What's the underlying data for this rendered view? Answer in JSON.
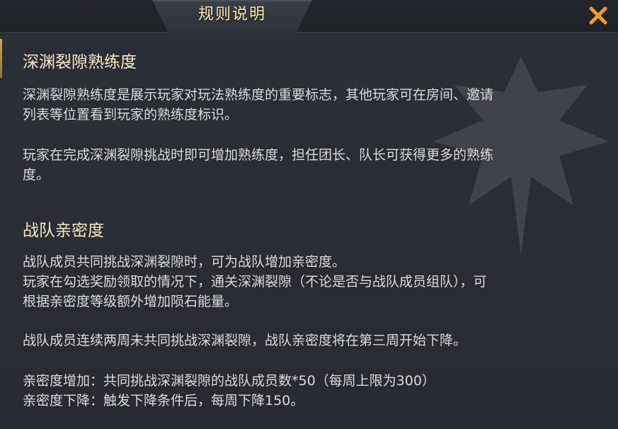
{
  "dialog": {
    "title": "规则说明",
    "close_icon": "close-icon",
    "colors": {
      "title": "#f6e7b0",
      "close": "#ff9a1a",
      "heading": "#f4e7c6",
      "body_text": "#d9d9d9"
    }
  },
  "sections": [
    {
      "heading": "深渊裂隙熟练度",
      "paragraphs": [
        [
          "深渊裂隙熟练度是展示玩家对玩法熟练度的重要标志，其他玩家可在房间、邀请",
          "列表等位置看到玩家的熟练度标识。"
        ],
        [
          "玩家在完成深渊裂隙挑战时即可增加熟练度，担任团长、队长可获得更多的熟练",
          "度。"
        ]
      ]
    },
    {
      "heading": "战队亲密度",
      "paragraphs": [
        [
          "战队成员共同挑战深渊裂隙时，可为战队增加亲密度。",
          "玩家在勾选奖励领取的情况下，通关深渊裂隙（不论是否与战队成员组队），可",
          "根据亲密度等级额外增加陨石能量。"
        ],
        [
          "战队成员连续两周未共同挑战深渊裂隙，战队亲密度将在第三周开始下降。"
        ],
        [
          "亲密度增加：共同挑战深渊裂隙的战队成员数*50（每周上限为300）",
          "亲密度下降：触发下降条件后，每周下降150。"
        ]
      ]
    }
  ]
}
